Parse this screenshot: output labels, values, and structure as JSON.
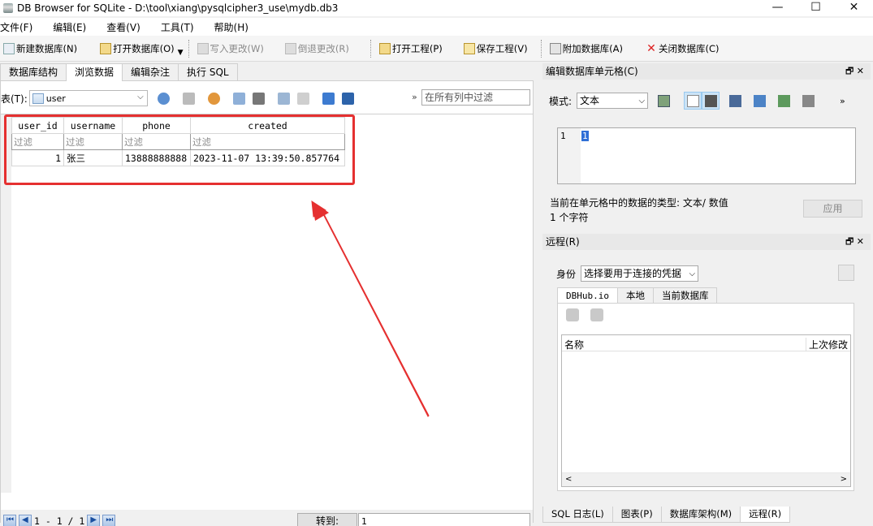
{
  "window": {
    "title": "DB Browser for SQLite - D:\\tool\\xiang\\pysqlcipher3_use\\mydb.db3",
    "min": "—",
    "max": "☐",
    "close": "✕"
  },
  "menu": [
    "文件(F)",
    "编辑(E)",
    "查看(V)",
    "工具(T)",
    "帮助(H)"
  ],
  "toolbar": {
    "new_db": "新建数据库(N)",
    "open_db": "打开数据库(O)",
    "write_changes": "写入更改(W)",
    "revert_changes": "倒退更改(R)",
    "open_project": "打开工程(P)",
    "save_project": "保存工程(V)",
    "attach_db": "附加数据库(A)",
    "close_db": "关闭数据库(C)"
  },
  "tabs": [
    "数据库结构",
    "浏览数据",
    "编辑杂注",
    "执行 SQL"
  ],
  "browse": {
    "table_label": "表(T):",
    "table_value": "user",
    "filter_all_placeholder": "在所有列中过滤",
    "more": "»",
    "columns": [
      "user_id",
      "username",
      "phone",
      "created"
    ],
    "filter_placeholder": "过滤",
    "rows": [
      {
        "user_id": "1",
        "username": "张三",
        "phone": "13888888888",
        "created": "2023-11-07 13:39:50.857764"
      }
    ],
    "pager": "1 - 1 / 1",
    "goto_label": "转到:",
    "goto_value": "1"
  },
  "edit_cell": {
    "title": "编辑数据库单元格(C)",
    "dock_ctrls": "🗗 ✕",
    "mode_label": "模式:",
    "mode_value": "文本",
    "more": "»",
    "line_no": "1",
    "content": "1",
    "type_info": "当前在单元格中的数据的类型: 文本/ 数值",
    "chars": "1 个字符",
    "apply": "应用"
  },
  "remote": {
    "title": "远程(R)",
    "dock_ctrls": "🗗 ✕",
    "identity_label": "身份",
    "identity_value": "选择要用于连接的凭据",
    "tabs": [
      "DBHub.io",
      "本地",
      "当前数据库"
    ],
    "col_name": "名称",
    "col_modified": "上次修改"
  },
  "bottom_tabs": [
    "SQL 日志(L)",
    "图表(P)",
    "数据库架构(M)",
    "远程(R)"
  ],
  "colors": {
    "annotation": "#e53030",
    "accent": "#2f6fd6"
  }
}
